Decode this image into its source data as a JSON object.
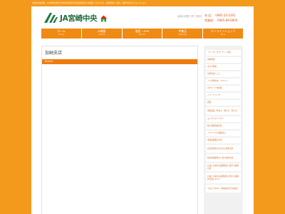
{
  "top_strip": {
    "text": "宮崎県中央地域、JA宮崎中央管内で管内の地区別の生産者情報などを掲載しております。営業時間のご案内、各種手続きなどはこちらから"
  },
  "header": {
    "logo_text": "JA宮崎中央",
    "note": "地域の仲間と夢と未来を",
    "contact": [
      {
        "label": "本 店：",
        "value": "0985-20-1001"
      },
      {
        "label": "営業部：",
        "value": "0985-89-6800"
      }
    ]
  },
  "nav": [
    {
      "label": "ホーム",
      "sub": "Home"
    },
    {
      "label": "JA概要",
      "sub": "Outline"
    },
    {
      "label": "施設・ATM",
      "sub": "Branch"
    },
    {
      "label": "特集品",
      "sub": "Specialty"
    },
    {
      "label": "オンラインショップ",
      "sub": "Shop"
    }
  ],
  "main": {
    "title": "加納支店",
    "bar_label": "Branch"
  },
  "sidebar": {
    "items": [
      "ファーマーズマーケット相だ",
      "採用情報",
      "みやざ情報",
      "宮崎生協くらし",
      "ＪＡ宮崎中央　ＳＤＧｓ",
      "JAグループの取組",
      "イメージソング",
      "農業",
      "金融商品（貯める・預かる・借りる）",
      "エンゲルライブラリ",
      "個人情報保護方針",
      "ＪＡバンクの相談窓口",
      "金融商品販売方針",
      "反社会的勢力に対する基本方針",
      "利用者保護等のための基本方針",
      "お客さま本位の業務運営に関する取組方針",
      "お客さま本位の業務運営に関する取組状況及びＫＰＩ",
      "つみたてNISA・国内株式市況の確認"
    ]
  }
}
